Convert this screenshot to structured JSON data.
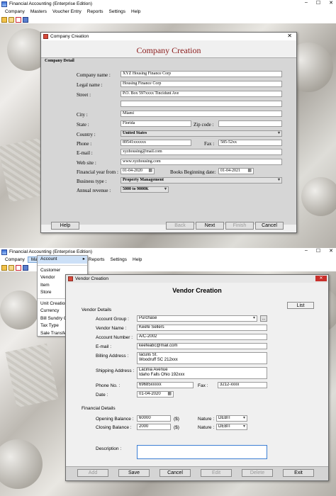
{
  "app": {
    "title": "Financial Accounting (Enterprise Edition)",
    "menu": [
      "Company",
      "Masters",
      "Voucher Entry",
      "Reports",
      "Settings",
      "Help"
    ]
  },
  "company_window": {
    "title": "Company Creation",
    "heading": "Company Creation",
    "section": "Company Detail",
    "labels": {
      "company_name": "Company name :",
      "legal_name": "Legal name :",
      "street": "Street :",
      "city": "City :",
      "state": "State :",
      "zip": "Zip code :",
      "country": "Country :",
      "phone": "Phone :",
      "fax": "Fax :",
      "email": "E-mail :",
      "website": "Web site :",
      "fy_from": "Financial year from :",
      "books_begin": "Books Beginning date:",
      "business_type": "Business type :",
      "annual_revenue": "Annual revenue :"
    },
    "values": {
      "company_name": "XYZ Housing Finance Corp",
      "legal_name": "Housing Finance Corp",
      "street": "P.O. Box 597xxxx Tincidunt Ave",
      "street2": "",
      "city": "Miami",
      "state": "Florida",
      "zip": "",
      "country": "United States",
      "phone": "89541xxxxxx",
      "fax": "585-52xx",
      "email": "xyzhousing@mail.com",
      "website": "www.xyzhousing.com",
      "fy_from": "01-04-2020",
      "books_begin": "01-04-2021",
      "business_type": "Property Management",
      "annual_revenue": "5000 to 9000K"
    },
    "buttons": {
      "help": "Help",
      "back": "Back",
      "next": "Next",
      "finish": "Finish",
      "cancel": "Cancel"
    }
  },
  "masters_menu": {
    "items": [
      "Account",
      "Customer",
      "Vendor",
      "Item",
      "Store",
      "Unit Creation",
      "Currency",
      "Bill Sundry Cr",
      "Tax Type",
      "Sale Transfer"
    ],
    "submenu_arrow": "▸"
  },
  "vendor_window": {
    "title": "Vendor Creation",
    "heading": "Vendor Creation",
    "list_button": "List",
    "vendor_details": "Vendor Details",
    "financial_details": "Financial Details",
    "labels": {
      "account_group": "Account Group :",
      "vendor_name": "Vendor Name :",
      "account_number": "Account Number :",
      "email": "E-mail :",
      "billing_address": "Billing Address :",
      "shipping_address": "Shipping Address :",
      "phone": "Phone No. :",
      "fax": "Fax :",
      "date": "Date :",
      "opening_balance": "Opening Balance :",
      "closing_balance": "Closing Balance :",
      "currency": "($)",
      "nature": "Nature :",
      "description": "Description :"
    },
    "values": {
      "account_group": "Purchase",
      "vendor_name": "Keefe Sellers",
      "account_number": "A/C-2002",
      "email": "keefeabc@mail.com",
      "billing_line1": "Iaculis St.",
      "billing_line2": "Woodruff SC 212xxx",
      "shipping_line1": "Lacinia Avenue",
      "shipping_line2": "Idaho Falls Ohio 192xxx",
      "phone": "69685xxxxx",
      "fax": "3212-xxxx",
      "date": "01-04-2020",
      "opening_balance": "60000",
      "closing_balance": "2000",
      "nature_opening": "DEBIT",
      "nature_closing": "DEBIT",
      "browse": "..."
    },
    "buttons": {
      "add": "Add",
      "save": "Save",
      "cancel": "Cancel",
      "edit": "Edit",
      "delete": "Delete",
      "exit": "Exit"
    }
  }
}
